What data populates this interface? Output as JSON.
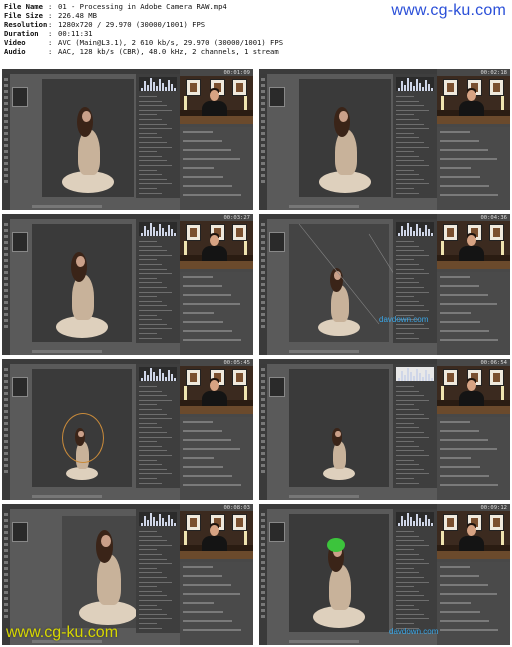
{
  "info": {
    "rows": [
      {
        "key": "File Name",
        "value": "01 - Processing in Adobe Camera RAW.mp4"
      },
      {
        "key": "File Size",
        "value": "226.48 MB"
      },
      {
        "key": "Resolution",
        "value": "1280x720 / 29.970 (30000/1001) FPS"
      },
      {
        "key": "Duration",
        "value": "00:11:31"
      },
      {
        "key": "Video",
        "value": "AVC (Main@L3.1), 2 610 kb/s, 29.970 (30000/1001) FPS"
      },
      {
        "key": "Audio",
        "value": "AAC, 128 kb/s (CBR), 48.0 kHz, 2 channels, 1 stream"
      }
    ],
    "separator": ":"
  },
  "watermarks": {
    "top": "www.cg-ku.com",
    "bottom": "www.cg-ku.com",
    "davdown": "davdown.com"
  },
  "thumbnails": [
    {
      "timestamp": "00:01:09"
    },
    {
      "timestamp": "00:02:18"
    },
    {
      "timestamp": "00:03:27"
    },
    {
      "timestamp": "00:04:36"
    },
    {
      "timestamp": "00:05:45"
    },
    {
      "timestamp": "00:06:54"
    },
    {
      "timestamp": "00:08:03"
    },
    {
      "timestamp": "00:09:12"
    }
  ],
  "colors": {
    "watermark_top": "#2a4fd8",
    "watermark_bottom": "#d8d800",
    "davdown": "#3aa7e8",
    "ps_background": "#5a5a5a",
    "dress": "#c8b29a"
  }
}
